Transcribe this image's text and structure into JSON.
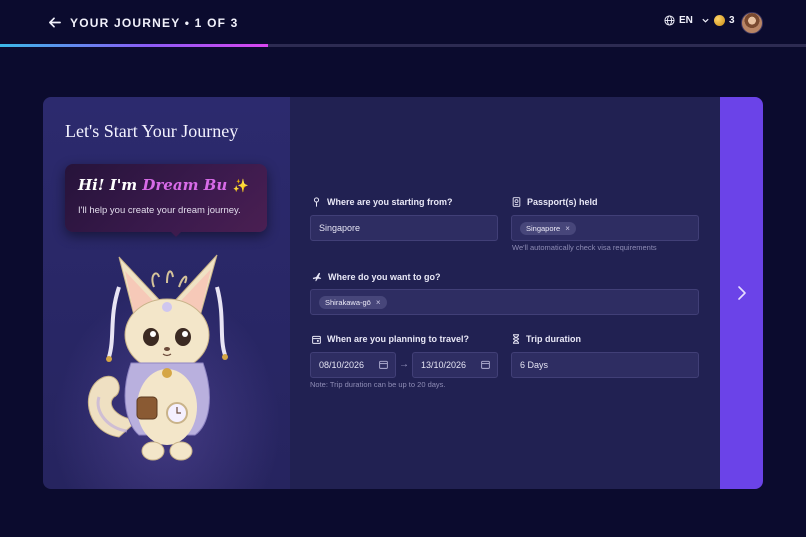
{
  "header": {
    "title": "YOUR JOURNEY • 1 OF 3",
    "language": "EN",
    "coins": "3",
    "progress": 0.333
  },
  "left": {
    "title": "Let's Start Your Journey",
    "greeting_prefix": "Hi! I'm ",
    "greeting_name": "Dream Bu",
    "greeting_sparkle": "✨",
    "greeting_sub": "I'll help you create your dream journey."
  },
  "form": {
    "origin": {
      "label": "Where are you starting from?",
      "value": "Singapore"
    },
    "passport": {
      "label": "Passport(s) held",
      "chips": [
        "Singapore"
      ],
      "helper": "We'll automatically check visa requirements"
    },
    "destination": {
      "label": "Where do you want to go?",
      "chips": [
        "Shirakawa-gō"
      ]
    },
    "dates": {
      "label": "When are you planning to travel?",
      "start": "08/10/2026",
      "end": "13/10/2026",
      "arrow": "→",
      "note": "Note: Trip duration can be up to 20 days."
    },
    "duration": {
      "label": "Trip duration",
      "value": "6 Days"
    },
    "chip_remove": "×"
  },
  "icons": {
    "back": "arrow-left-icon",
    "globe": "globe-icon",
    "chevron": "chevron-down-icon",
    "coin": "coin-icon",
    "pin": "pin-icon",
    "passport": "passport-icon",
    "plane": "plane-icon",
    "calendar": "calendar-icon",
    "hourglass": "hourglass-icon",
    "next": "chevron-right-icon"
  },
  "colors": {
    "background": "#0b0b2e",
    "left_panel": "#2c2a6e",
    "form_panel": "#212152",
    "accent": "#6b43e8",
    "name_highlight": "#d86be8"
  }
}
